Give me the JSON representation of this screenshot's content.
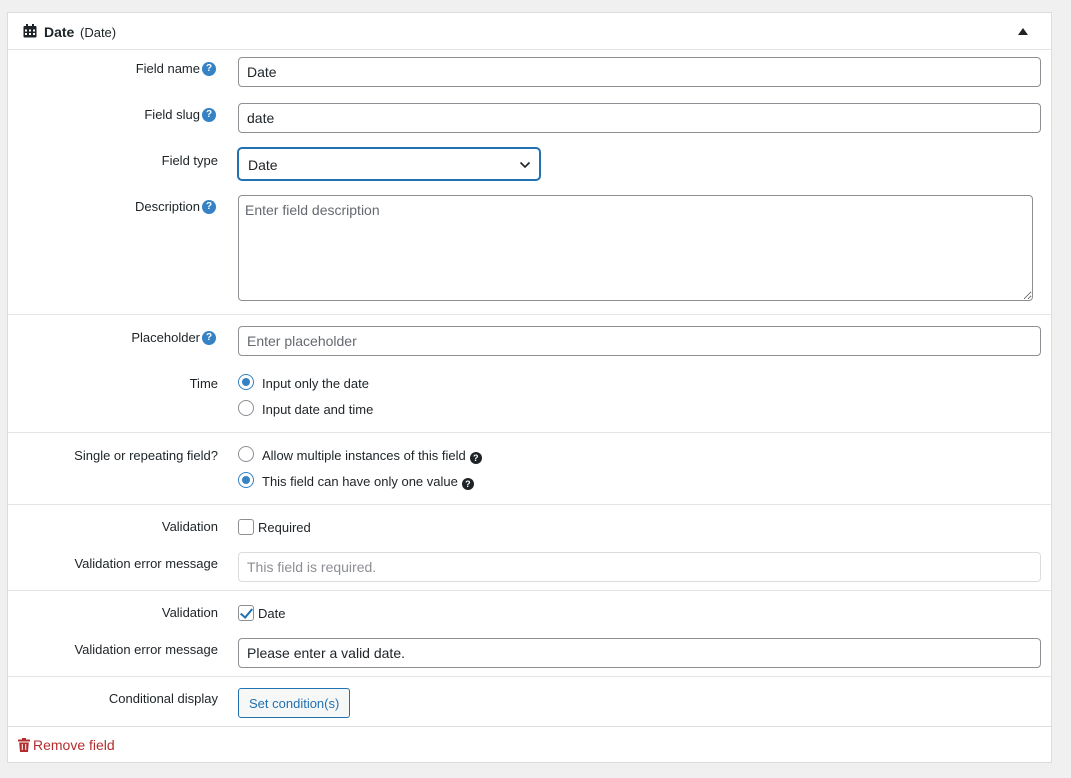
{
  "header": {
    "title": "Date",
    "subtitle": "(Date)",
    "icon": "calendar-icon"
  },
  "fields": {
    "field_name": {
      "label": "Field name",
      "value": "Date"
    },
    "field_slug": {
      "label": "Field slug",
      "value": "date"
    },
    "field_type": {
      "label": "Field type",
      "value": "Date"
    },
    "description": {
      "label": "Description",
      "placeholder": "Enter field description"
    },
    "placeholder": {
      "label": "Placeholder",
      "placeholder": "Enter placeholder"
    },
    "time": {
      "label": "Time",
      "options": [
        {
          "label": "Input only the date",
          "checked": true
        },
        {
          "label": "Input date and time",
          "checked": false
        }
      ]
    },
    "repeating": {
      "label": "Single or repeating field?",
      "options": [
        {
          "label": "Allow multiple instances of this field",
          "checked": false
        },
        {
          "label": "This field can have only one value",
          "checked": true
        }
      ]
    },
    "validation_required": {
      "label": "Validation",
      "checkbox_label": "Required",
      "checked": false,
      "error_label": "Validation error message",
      "error_placeholder": "This field is required."
    },
    "validation_date": {
      "label": "Validation",
      "checkbox_label": "Date",
      "checked": true,
      "error_label": "Validation error message",
      "error_value": "Please enter a valid date."
    },
    "conditional": {
      "label": "Conditional display",
      "button_label": "Set condition(s)"
    }
  },
  "help_glyph": "?",
  "footer": {
    "remove_label": "Remove field",
    "icon": "trash-icon"
  },
  "colors": {
    "accent": "#2271b1",
    "help": "#3582c4",
    "danger": "#b32d2e"
  }
}
